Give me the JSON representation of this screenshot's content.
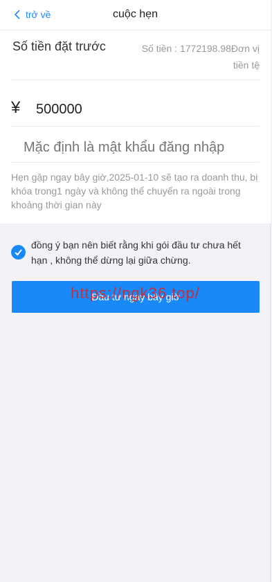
{
  "nav": {
    "back_label": "trở về",
    "title": "cuộc hẹn"
  },
  "deposit": {
    "label": "Số tiền đặt trước",
    "balance_text": "Số tiền : 1772198.98Đơn vị tiền tệ",
    "currency_symbol": "¥",
    "amount": "500000",
    "password_placeholder": "Mặc định là mật khẩu đăng nhập",
    "note": "Hẹn gặp ngay bây giờ,2025-01-10 sẽ tạo ra doanh thu, bị khóa trong1 ngày và không thể chuyển ra ngoài trong khoảng thời gian này"
  },
  "agreement": {
    "checked": true,
    "text": "đồng ý bạn nên biết rằng khi gói đầu tư chưa hết hạn , không thể dừng lại giữa chừng."
  },
  "submit": {
    "label": "Đầu tư ngay bây giờ"
  },
  "watermark": {
    "text": "https://ngk36.top/"
  },
  "colors": {
    "accent": "#1989fa",
    "watermark": "#e0201a",
    "background": "#f2f2f7"
  },
  "icons": {
    "back": "chevron-left-icon",
    "check": "check-icon"
  }
}
